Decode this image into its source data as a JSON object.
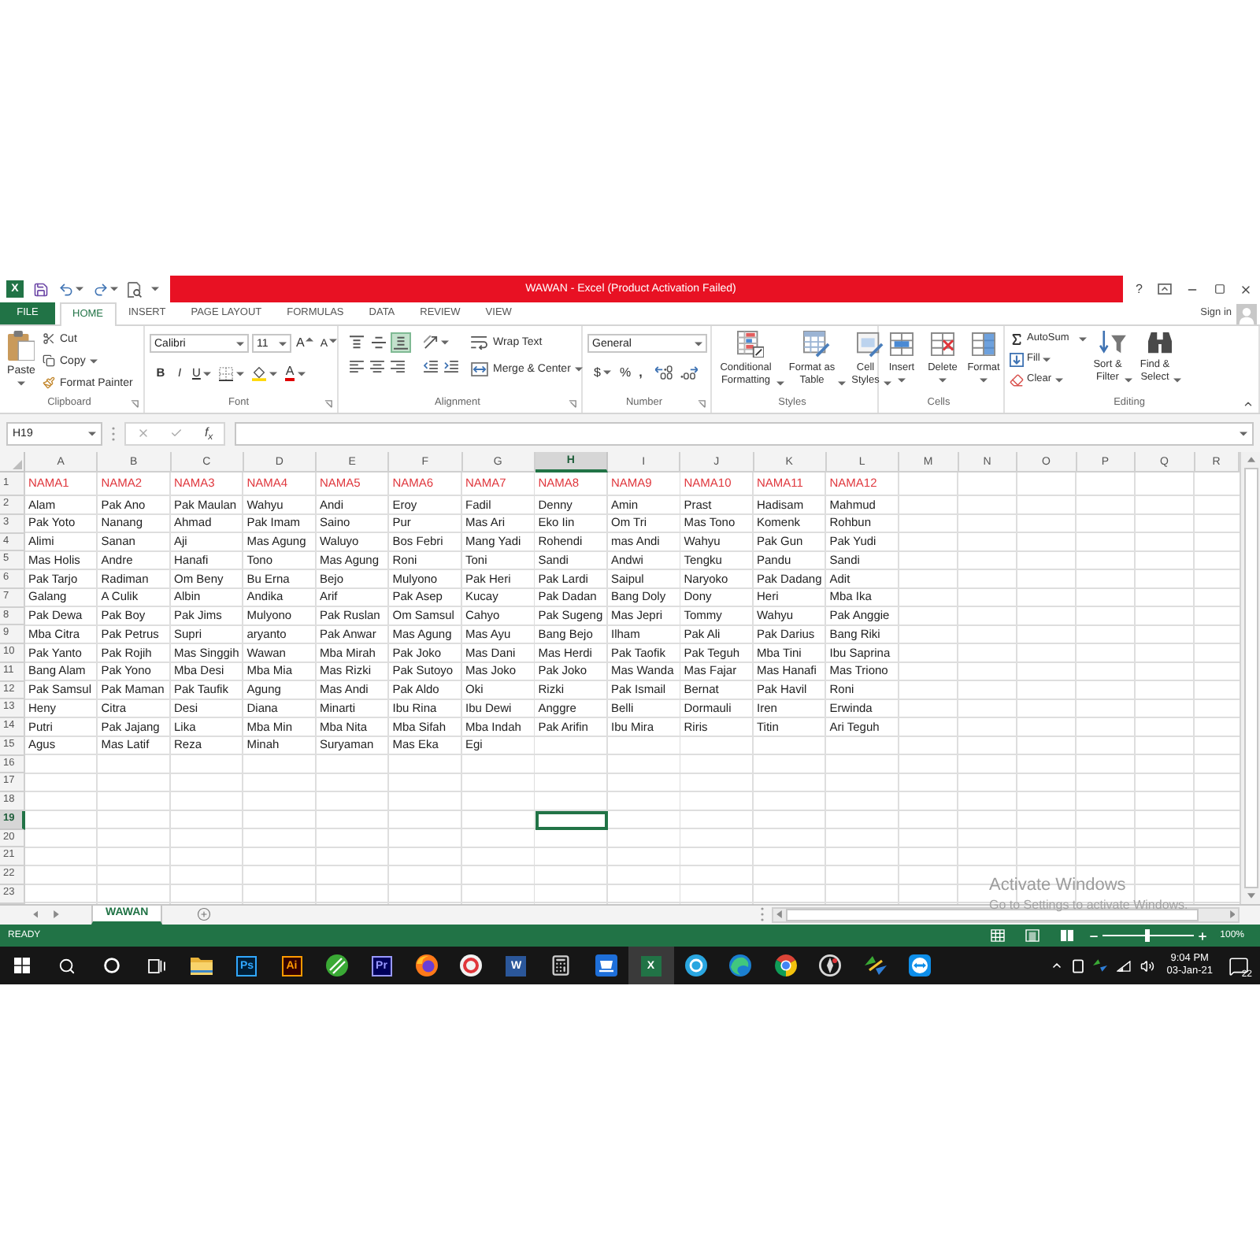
{
  "window": {
    "app_glyph": "X",
    "title": "WAWAN - Excel (Product Activation Failed)",
    "help": "?"
  },
  "tabs": [
    {
      "label": "FILE",
      "kind": "backstage",
      "selected": false
    },
    {
      "label": "HOME",
      "kind": "tab",
      "selected": true
    },
    {
      "label": "INSERT",
      "kind": "tab",
      "selected": false
    },
    {
      "label": "PAGE LAYOUT",
      "kind": "tab",
      "selected": false
    },
    {
      "label": "FORMULAS",
      "kind": "tab",
      "selected": false
    },
    {
      "label": "DATA",
      "kind": "tab",
      "selected": false
    },
    {
      "label": "REVIEW",
      "kind": "tab",
      "selected": false
    },
    {
      "label": "VIEW",
      "kind": "tab",
      "selected": false
    }
  ],
  "account": {
    "sign_in": "Sign in"
  },
  "ribbon": {
    "clipboard": {
      "label": "Clipboard",
      "paste": "Paste",
      "cut": "Cut",
      "copy": "Copy",
      "format_painter": "Format Painter"
    },
    "font": {
      "label": "Font",
      "font_name": "Calibri",
      "font_size": "11",
      "grow": "A",
      "shrink": "A",
      "bold": "B",
      "italic": "I",
      "underline": "U",
      "font_color": "A"
    },
    "alignment": {
      "label": "Alignment",
      "vertical": [
        {
          "selected": false
        },
        {
          "selected": false
        },
        {
          "selected": true
        }
      ],
      "wrap_text": "Wrap Text",
      "merge_center": "Merge & Center"
    },
    "number": {
      "label": "Number",
      "format": "General",
      "currency": "$",
      "percent": "%",
      "comma": ","
    },
    "styles": {
      "label": "Styles",
      "buttons": [
        "Conditional Formatting",
        "Format as Table",
        "Cell Styles"
      ]
    },
    "cells": {
      "label": "Cells",
      "buttons": [
        "Insert",
        "Delete",
        "Format"
      ]
    },
    "editing": {
      "label": "Editing",
      "autosum": "AutoSum",
      "fill": "Fill",
      "clear": "Clear",
      "sort_filter": "Sort & Filter",
      "find_select": "Find & Select"
    }
  },
  "formula_bar": {
    "name_box": "H19",
    "function_glyph": "f$_{x}$"
  },
  "sheet": {
    "columns": [
      {
        "label": "A",
        "selected": false
      },
      {
        "label": "B",
        "selected": false
      },
      {
        "label": "C",
        "selected": false
      },
      {
        "label": "D",
        "selected": false
      },
      {
        "label": "E",
        "selected": false
      },
      {
        "label": "F",
        "selected": false
      },
      {
        "label": "G",
        "selected": false
      },
      {
        "label": "H",
        "selected": true
      },
      {
        "label": "I",
        "selected": false
      },
      {
        "label": "J",
        "selected": false
      },
      {
        "label": "K",
        "selected": false
      },
      {
        "label": "L",
        "selected": false
      },
      {
        "label": "M",
        "selected": false
      },
      {
        "label": "N",
        "selected": false
      },
      {
        "label": "O",
        "selected": false
      },
      {
        "label": "P",
        "selected": false
      },
      {
        "label": "Q",
        "selected": false
      },
      {
        "label": "R",
        "selected": false
      }
    ],
    "rows": [
      {
        "number": "1",
        "kind": "heading",
        "selected": false,
        "cells": [
          "NAMA1",
          "NAMA2",
          "NAMA3",
          "NAMA4",
          "NAMA5",
          "NAMA6",
          "NAMA7",
          "NAMA8",
          "NAMA9",
          "NAMA10",
          "NAMA11",
          "NAMA12"
        ]
      },
      {
        "number": "2",
        "kind": "data",
        "selected": false,
        "cells": [
          "Alam",
          "Pak Ano",
          "Pak Maulan",
          "Wahyu",
          "Andi",
          "Eroy",
          "Fadil",
          "Denny",
          "Amin",
          "Prast",
          "Hadisam",
          "Mahmud"
        ]
      },
      {
        "number": "3",
        "kind": "data",
        "selected": false,
        "cells": [
          "Pak Yoto",
          "Nanang",
          "Ahmad",
          "Pak Imam",
          "Saino",
          "Pur",
          "Mas Ari",
          "Eko Iin",
          "Om Tri",
          "Mas Tono",
          "Komenk",
          "Rohbun"
        ]
      },
      {
        "number": "4",
        "kind": "data",
        "selected": false,
        "cells": [
          "Alimi",
          "Sanan",
          "Aji",
          "Mas Agung",
          "Waluyo",
          "Bos Febri",
          "Mang Yadi",
          "Rohendi",
          "mas Andi",
          "Wahyu",
          "Pak Gun",
          "Pak Yudi"
        ]
      },
      {
        "number": "5",
        "kind": "data",
        "selected": false,
        "cells": [
          "Mas Holis",
          "Andre",
          "Hanafi",
          "Tono",
          "Mas Agung",
          "Roni",
          "Toni",
          "Sandi",
          "Andwi",
          "Tengku",
          "Pandu",
          "Sandi"
        ]
      },
      {
        "number": "6",
        "kind": "data",
        "selected": false,
        "cells": [
          "Pak Tarjo",
          "Radiman",
          "Om Beny",
          "Bu Erna",
          "Bejo",
          "Mulyono",
          "Pak Heri",
          "Pak Lardi",
          "Saipul",
          "Naryoko",
          "Pak Dadang",
          "Adit"
        ]
      },
      {
        "number": "7",
        "kind": "data",
        "selected": false,
        "cells": [
          "Galang",
          "A Culik",
          "Albin",
          "Andika",
          "Arif",
          "Pak Asep",
          "Kucay",
          "Pak Dadan",
          "Bang Doly",
          "Dony",
          "Heri",
          "Mba Ika"
        ]
      },
      {
        "number": "8",
        "kind": "data",
        "selected": false,
        "cells": [
          "Pak Dewa",
          "Pak Boy",
          "Pak Jims",
          "Mulyono",
          "Pak Ruslan",
          "Om Samsul",
          "Cahyo",
          "Pak Sugeng",
          "Mas Jepri",
          "Tommy",
          "Wahyu",
          "Pak Anggie"
        ]
      },
      {
        "number": "9",
        "kind": "data",
        "selected": false,
        "cells": [
          "Mba Citra",
          "Pak Petrus",
          "Supri",
          "aryanto",
          "Pak Anwar",
          "Mas Agung",
          "Mas Ayu",
          "Bang Bejo",
          "Ilham",
          "Pak Ali",
          "Pak Darius",
          "Bang Riki"
        ]
      },
      {
        "number": "10",
        "kind": "data",
        "selected": false,
        "cells": [
          "Pak Yanto",
          "Pak Rojih",
          "Mas Singgih",
          "Wawan",
          "Mba Mirah",
          "Pak Joko",
          "Mas Dani",
          "Mas Herdi",
          "Pak Taofik",
          "Pak Teguh",
          "Mba Tini",
          "Ibu Saprina"
        ]
      },
      {
        "number": "11",
        "kind": "data",
        "selected": false,
        "cells": [
          "Bang Alam",
          "Pak Yono",
          "Mba Desi",
          "Mba Mia",
          "Mas Rizki",
          "Pak Sutoyo",
          "Mas Joko",
          "Pak Joko",
          "Mas Wanda",
          "Mas Fajar",
          "Mas Hanafi",
          "Mas Triono"
        ]
      },
      {
        "number": "12",
        "kind": "data",
        "selected": false,
        "cells": [
          "Pak Samsul",
          "Pak Maman",
          "Pak Taufik",
          "Agung",
          "Mas Andi",
          "Pak Aldo",
          "Oki",
          "Rizki",
          "Pak Ismail",
          "Bernat",
          "Pak Havil",
          "Roni"
        ]
      },
      {
        "number": "13",
        "kind": "data",
        "selected": false,
        "cells": [
          "Heny",
          "Citra",
          "Desi",
          "Diana",
          "Minarti",
          "Ibu Rina",
          "Ibu Dewi",
          "Anggre",
          "Belli",
          "Dormauli",
          "Iren",
          "Erwinda"
        ]
      },
      {
        "number": "14",
        "kind": "data",
        "selected": false,
        "cells": [
          "Putri",
          "Pak Jajang",
          "Lika",
          "Mba Min",
          "Mba Nita",
          "Mba Sifah",
          "Mba Indah",
          "Pak Arifin",
          "Ibu Mira",
          "Riris",
          "Titin",
          "Ari Teguh"
        ]
      },
      {
        "number": "15",
        "kind": "data",
        "selected": false,
        "cells": [
          "Agus",
          "Mas Latif",
          "Reza",
          "Minah",
          "Suryaman",
          "Mas Eka",
          "Egi"
        ]
      },
      {
        "number": "16",
        "kind": "data",
        "selected": false
      },
      {
        "number": "17",
        "kind": "data",
        "selected": false
      },
      {
        "number": "18",
        "kind": "data",
        "selected": false
      },
      {
        "number": "19",
        "kind": "data",
        "selected": true
      },
      {
        "number": "20",
        "kind": "data",
        "selected": false
      },
      {
        "number": "21",
        "kind": "data",
        "selected": false
      },
      {
        "number": "22",
        "kind": "data",
        "selected": false
      },
      {
        "number": "23",
        "kind": "data",
        "selected": false
      }
    ]
  },
  "sheet_tabs": [
    {
      "label": "WAWAN",
      "selected": true
    }
  ],
  "activation_notice": {
    "title": "Activate Windows",
    "message": "Go to Settings to activate Windows."
  },
  "status_bar": {
    "status": "READY",
    "zoom": {
      "level": 0.5,
      "reading": "100%"
    }
  },
  "taskbar": {
    "apps": [
      {
        "kind": "folder",
        "active": false
      },
      {
        "kind": "photo_editor",
        "glyph": "Ps",
        "active": false
      },
      {
        "kind": "vector_editor",
        "glyph": "Ai",
        "active": false
      },
      {
        "kind": "striped_ball",
        "active": false
      },
      {
        "kind": "video_editor",
        "glyph": "Pr",
        "active": false
      },
      {
        "kind": "fox_browser",
        "active": false
      },
      {
        "kind": "ring",
        "active": false
      },
      {
        "kind": "document_editor",
        "glyph": "W",
        "active": false
      },
      {
        "kind": "calculator",
        "active": false
      },
      {
        "kind": "scanner",
        "active": false
      },
      {
        "kind": "spreadsheet",
        "glyph": "X",
        "active": true
      },
      {
        "kind": "bubble",
        "active": false
      },
      {
        "kind": "wave_browser",
        "active": false
      },
      {
        "kind": "segmented_browser",
        "active": false
      },
      {
        "kind": "aperture",
        "active": false
      },
      {
        "kind": "download_arrows",
        "active": false
      },
      {
        "kind": "remote_arrows",
        "active": false
      }
    ],
    "clock": {
      "time": "9:04 PM",
      "date": "03-Jan-21"
    },
    "notifications": "22"
  }
}
